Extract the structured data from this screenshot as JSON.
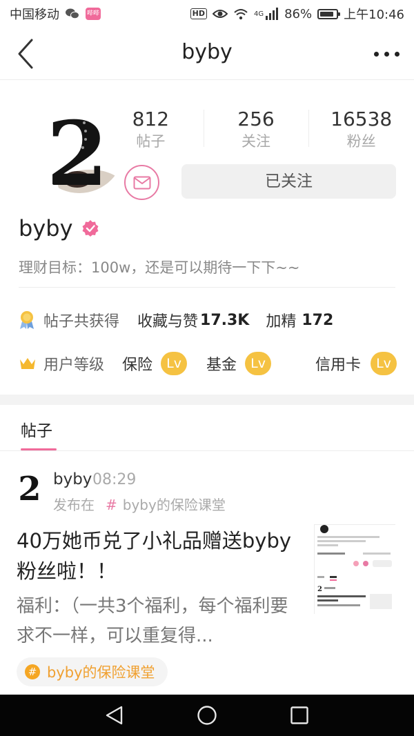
{
  "status_bar": {
    "carrier": "中国移动",
    "app_badge": "哔哔",
    "hd": "HD",
    "network": "4G",
    "battery": "86%",
    "battery_level": 0.86,
    "time": "上午10:46"
  },
  "nav": {
    "title": "byby",
    "back_icon": "chevron-left-icon",
    "more_icon": "more-dots-icon"
  },
  "profile": {
    "avatar_glyph": "2",
    "stats": [
      {
        "value": "812",
        "label": "帖子"
      },
      {
        "value": "256",
        "label": "关注"
      },
      {
        "value": "16538",
        "label": "粉丝"
      }
    ],
    "follow_label": "已关注",
    "username": "byby",
    "bio": "理财目标：100w，还是可以期待一下下~~"
  },
  "awards": {
    "label": "帖子共获得",
    "likes_label": "收藏与赞",
    "likes_value": "17.3K",
    "featured_label": "加精",
    "featured_value": "172"
  },
  "levels": {
    "label": "用户等级",
    "items": [
      {
        "name": "保险",
        "badge": "Lv"
      },
      {
        "name": "基金",
        "badge": "Lv"
      },
      {
        "name": "信用卡",
        "badge": "Lv"
      }
    ]
  },
  "tabs": {
    "active": "帖子"
  },
  "post": {
    "author": "byby",
    "time": "08:29",
    "published_in_label": "发布在",
    "hash": "#",
    "channel": "byby的保险课堂",
    "title": "40万她币兑了小礼品赠送byby粉丝啦！！",
    "excerpt": "福利：（一共3个福利，每个福利要求不一样，可以重复得...",
    "tag": "byby的保险课堂",
    "tag_icon": "#"
  },
  "colors": {
    "accent_pink": "#f06a9a",
    "level_gold": "#f5c242",
    "tag_orange": "#f0a030"
  }
}
